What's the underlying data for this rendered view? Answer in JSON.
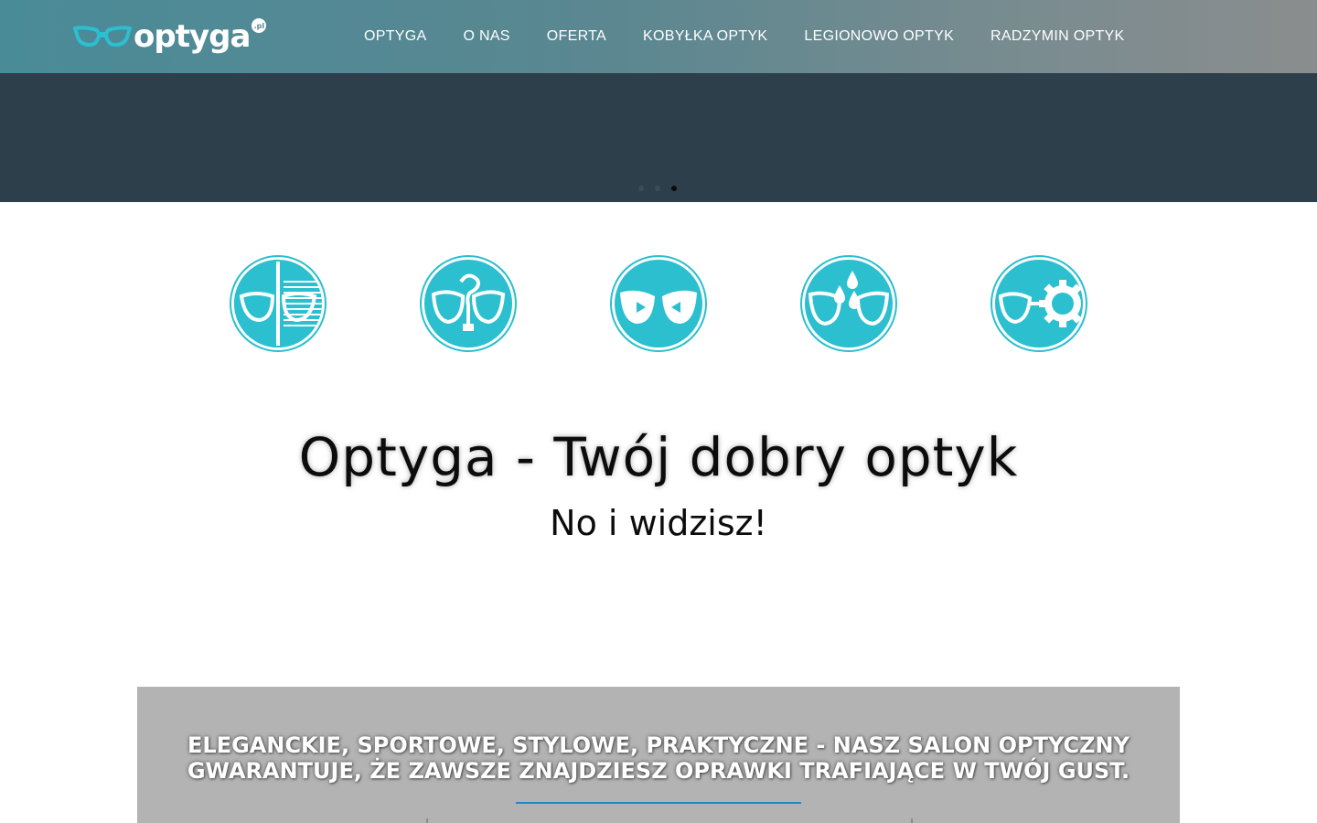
{
  "brand": {
    "logo_text": "optyga",
    "logo_badge": ".pl",
    "accent_color": "#2bbfcf",
    "header_gradient": [
      "#4a8b98",
      "#8a8d8e"
    ]
  },
  "nav": {
    "items": [
      {
        "label": "OPTYGA"
      },
      {
        "label": "O NAS"
      },
      {
        "label": "OFERTA"
      },
      {
        "label": "KOBYŁKA OPTYK"
      },
      {
        "label": "LEGIONOWO OPTYK"
      },
      {
        "label": "RADZYMIN OPTYK"
      }
    ]
  },
  "slider": {
    "dot_count": 3,
    "active_index": 2
  },
  "features": [
    {
      "icon": "glasses-gradient-lens-icon"
    },
    {
      "icon": "glasses-question-icon"
    },
    {
      "icon": "glasses-eyes-icon"
    },
    {
      "icon": "glasses-drops-icon"
    },
    {
      "icon": "glasses-gear-icon"
    }
  ],
  "main": {
    "headline": "Optyga - Twój dobry optyk",
    "subline": "No i widzisz!"
  },
  "band": {
    "line1": "ELEGANCKIE, SPORTOWE, STYLOWE, PRAKTYCZNE - NASZ SALON OPTYCZNY",
    "line2": "GWARANTUJE, ŻE ZAWSZE ZNAJDZIESZ OPRAWKI TRAFIAJĄCE W TWÓJ GUST."
  }
}
